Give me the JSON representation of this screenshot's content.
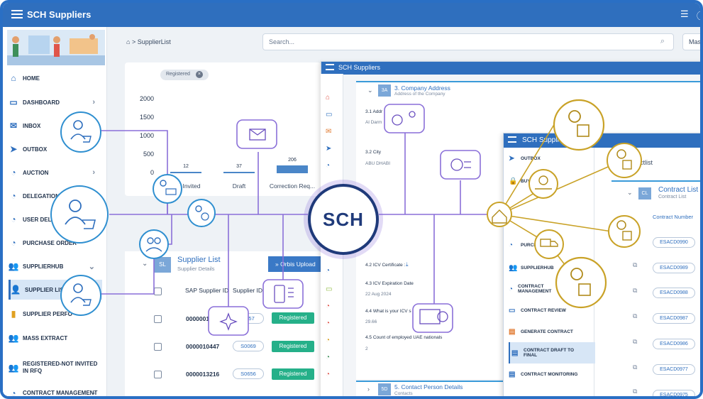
{
  "app": {
    "title": "SCH Suppliers",
    "hub_label": "SCH"
  },
  "sidebar": {
    "items": [
      {
        "label": "HOME",
        "icon": "home-icon"
      },
      {
        "label": "DASHBOARD",
        "icon": "dashboard-icon"
      },
      {
        "label": "INBOX",
        "icon": "inbox-icon"
      },
      {
        "label": "OUTBOX",
        "icon": "outbox-icon"
      },
      {
        "label": "AUCTION",
        "icon": "auction-icon"
      },
      {
        "label": "DELEGATION",
        "icon": "delegation-icon"
      },
      {
        "label": "USER DELEG",
        "icon": "user-delegation-icon"
      },
      {
        "label": "PURCHASE ORDER",
        "icon": "purchase-order-icon"
      },
      {
        "label": "SUPPLIERHUB",
        "icon": "supplierhub-icon"
      },
      {
        "label": "SUPPLIER LIST",
        "icon": "supplier-list-icon"
      },
      {
        "label": "SUPPLIER PERFO",
        "icon": "supplier-performance-icon"
      },
      {
        "label": "MASS EXTRACT",
        "icon": "mass-extract-icon"
      },
      {
        "label": "REGISTERED-NOT INVITED IN RFQ",
        "icon": "registered-icon"
      },
      {
        "label": "CONTRACT MANAGEMENT",
        "icon": "contract-icon"
      }
    ]
  },
  "breadcrumb": {
    "text": "SupplierList"
  },
  "search": {
    "placeholder": "Search...",
    "extra_button": "Mas"
  },
  "filter_chip": {
    "label": "Registered"
  },
  "chart_data": {
    "type": "bar",
    "categories": [
      "Invited",
      "Draft",
      "Correction Req..."
    ],
    "values": [
      12,
      37,
      206
    ],
    "yticks": [
      "2000",
      "1500",
      "1000",
      "500",
      "0"
    ],
    "ylim": [
      0,
      2000
    ],
    "color": "#4a86c8"
  },
  "supplier_list": {
    "badge": "SL",
    "title": "Supplier List",
    "subtitle": "Supplier Details",
    "orbis_button": "Orbis Upload",
    "columns": [
      "SAP Supplier ID",
      "Supplier ID"
    ],
    "rows": [
      {
        "sap_id": "00000013",
        "supplier_id": "S057",
        "status": "Registered"
      },
      {
        "sap_id": "0000010447",
        "supplier_id": "S0069",
        "status": "Registered"
      },
      {
        "sap_id": "0000013216",
        "supplier_id": "S0656",
        "status": "Registered"
      }
    ]
  },
  "window2": {
    "title": "SCH Suppliers",
    "section3": {
      "badge": "3A",
      "title": "3. Company Address",
      "subtitle": "Address of the Company"
    },
    "fields": [
      {
        "label": "3.1 Addr",
        "value": "Al Darm"
      },
      {
        "label": "3.2 City",
        "value": "ABU DHABI"
      },
      {
        "label": "4.2 ICV Certificate :",
        "value": ""
      },
      {
        "label": "4.3 ICV Expiration Date",
        "value": "22 Aug 2024"
      },
      {
        "label": "4.4 What is your ICV s",
        "value": "29.66"
      },
      {
        "label": "4.5 Count of employed UAE nationals",
        "value": "2"
      }
    ],
    "section5": {
      "badge": "5D",
      "title": "5. Contact Person Details",
      "subtitle": "Contacts"
    }
  },
  "window3": {
    "title": "SCH Supplie",
    "items": [
      {
        "label": "OUTBOX"
      },
      {
        "label": "BUY"
      },
      {
        "label": "PURCH"
      },
      {
        "label": "SUPPLIERHUB"
      },
      {
        "label": "CONTRACT MANAGEMENT"
      },
      {
        "label": "CONTRACT REVIEW"
      },
      {
        "label": "GENERATE CONTRACT"
      },
      {
        "label": "CONTRACT DRAFT TO FINAL"
      },
      {
        "label": "CONTRACT MONITORING"
      }
    ],
    "crumb_tail": "ctlist",
    "contract_list": {
      "badge": "CL",
      "title": "Contract List",
      "subtitle": "Contract List",
      "column": "Contract Number",
      "rows": [
        "ESACD0990",
        "ESACD0989",
        "ESACD0988",
        "ESACD0987",
        "ESACD0986",
        "ESACD0977",
        "ESACD0975"
      ]
    }
  }
}
